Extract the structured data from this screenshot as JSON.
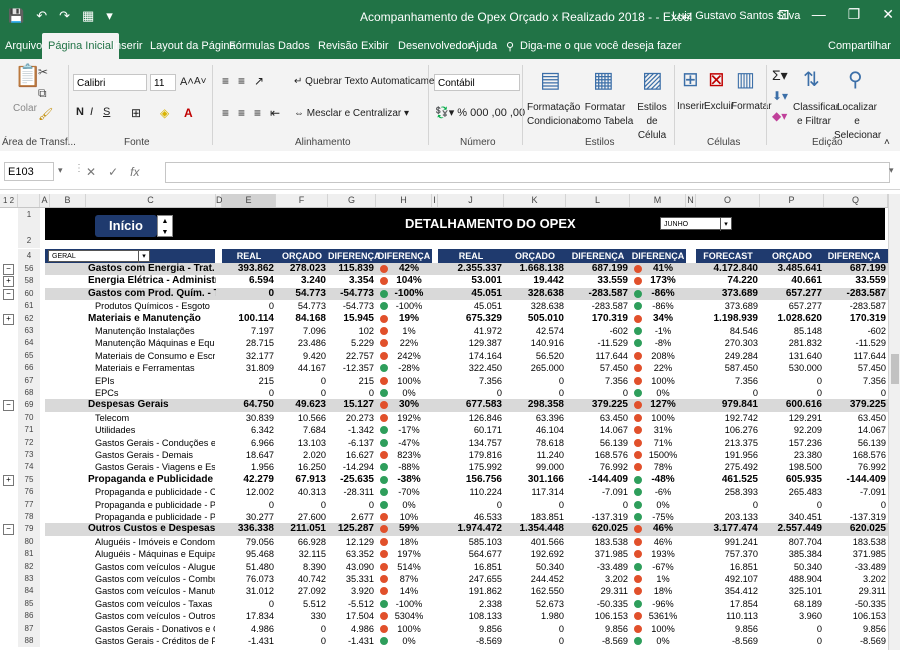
{
  "window": {
    "title": "Acompanhamento de Opex Orçado x Realizado 2018 -       -  Excel",
    "user": "Luiz Gustavo Santos Silva",
    "quick_access": [
      "💾",
      "↶",
      "↷",
      "▦",
      "▾"
    ],
    "win_controls": [
      "⊡",
      "—",
      "❐",
      "✕"
    ]
  },
  "ribbon_tabs": [
    "Arquivo",
    "Página Inicial",
    "Inserir",
    "Layout da Página",
    "Fórmulas",
    "Dados",
    "Revisão",
    "Exibir",
    "Desenvolvedor",
    "Ajuda"
  ],
  "tell_me": "Diga-me o que você deseja fazer",
  "share": "Compartilhar",
  "ribbon": {
    "paste": "Colar",
    "font_name": "Calibri",
    "font_size": "11",
    "wrap_text": "Quebrar Texto Automaticamente",
    "merge_center": "Mesclar e Centralizar",
    "number_format": "Contábil",
    "cond_format": "Formatação Condicional",
    "format_table": "Formatar como Tabela",
    "cell_styles": "Estilos de Célula",
    "insert": "Inserir",
    "delete": "Excluir",
    "format": "Formatar",
    "sort_filter": "Classificar e Filtrar",
    "find_select": "Localizar e Selecionar",
    "groups": [
      "Área de Transf...",
      "Fonte",
      "Alinhamento",
      "Número",
      "Estilos",
      "Células",
      "Edição"
    ]
  },
  "formula_bar": {
    "name_box": "E103",
    "formula": ""
  },
  "columns": [
    "A",
    "B",
    "C",
    "D",
    "E",
    "F",
    "G",
    "H",
    "I",
    "J",
    "K",
    "L",
    "M",
    "N",
    "O",
    "P",
    "Q"
  ],
  "dashboard": {
    "inicio": "Início",
    "title": "DETALHAMENTO DO OPEX",
    "month": "JUNHO",
    "filter": "GERAL",
    "headers": [
      "REAL",
      "ORÇADO",
      "DIFERENÇA",
      "DIFERENÇA (%)",
      "REAL",
      "ORÇADO",
      "DIFERENÇA",
      "DIFERENÇA (%)",
      "FORECAST",
      "ORÇADO",
      "DIFERENÇA"
    ]
  },
  "colors": {
    "green": "#2e9e5b",
    "red": "#e1502b",
    "navy": "#1f3a6e",
    "excel": "#217346"
  },
  "rows": [
    {
      "n": "56",
      "t": "hl",
      "label": "Gastos com Energia - Trat. de Esgoto",
      "v": [
        "393.862",
        "278.023",
        "115.839",
        "42%",
        "2.355.337",
        "1.668.138",
        "687.199",
        "41%",
        "4.172.840",
        "3.485.641",
        "687.199"
      ],
      "d1": "red",
      "d2": "red"
    },
    {
      "n": "58",
      "t": "sub",
      "label": "Energia Elétrica - Administrativo",
      "v": [
        "6.594",
        "3.240",
        "3.354",
        "104%",
        "53.001",
        "19.442",
        "33.559",
        "173%",
        "74.220",
        "40.661",
        "33.559"
      ],
      "d1": "red",
      "d2": "red"
    },
    {
      "n": "60",
      "t": "hl",
      "label": "Gastos com Prod. Quím. - Trat. Esgoto",
      "v": [
        "0",
        "54.773",
        "-54.773",
        "-100%",
        "45.051",
        "328.638",
        "-283.587",
        "-86%",
        "373.689",
        "657.277",
        "-283.587"
      ],
      "d1": "green",
      "d2": "green"
    },
    {
      "n": "61",
      "t": "",
      "label": "Produtos Químicos - Esgoto",
      "v": [
        "0",
        "54.773",
        "-54.773",
        "-100%",
        "45.051",
        "328.638",
        "-283.587",
        "-86%",
        "373.689",
        "657.277",
        "-283.587"
      ],
      "d1": "",
      "d2": ""
    },
    {
      "n": "62",
      "t": "sub",
      "label": "Materiais e Manutenção",
      "v": [
        "100.114",
        "84.168",
        "15.945",
        "19%",
        "675.329",
        "505.010",
        "170.319",
        "34%",
        "1.198.939",
        "1.028.620",
        "170.319"
      ],
      "d1": "red",
      "d2": "red"
    },
    {
      "n": "63",
      "t": "",
      "label": "Manutenção Instalações",
      "v": [
        "7.197",
        "7.096",
        "102",
        "1%",
        "41.972",
        "42.574",
        "-602",
        "-1%",
        "84.546",
        "85.148",
        "-602"
      ],
      "d1": "",
      "d2": ""
    },
    {
      "n": "64",
      "t": "",
      "label": "Manutenção Máquinas e Equipamentos",
      "v": [
        "28.715",
        "23.486",
        "5.229",
        "22%",
        "129.387",
        "140.916",
        "-11.529",
        "-8%",
        "270.303",
        "281.832",
        "-11.529"
      ],
      "d1": "",
      "d2": ""
    },
    {
      "n": "65",
      "t": "",
      "label": "Materiais de Consumo e Escritório",
      "v": [
        "32.177",
        "9.420",
        "22.757",
        "242%",
        "174.164",
        "56.520",
        "117.644",
        "208%",
        "249.284",
        "131.640",
        "117.644"
      ],
      "d1": "",
      "d2": ""
    },
    {
      "n": "66",
      "t": "",
      "label": "Materiais e Ferramentas",
      "v": [
        "31.809",
        "44.167",
        "-12.357",
        "-28%",
        "322.450",
        "265.000",
        "57.450",
        "22%",
        "587.450",
        "530.000",
        "57.450"
      ],
      "d1": "",
      "d2": ""
    },
    {
      "n": "67",
      "t": "",
      "label": "EPIs",
      "v": [
        "215",
        "0",
        "215",
        "100%",
        "7.356",
        "0",
        "7.356",
        "100%",
        "7.356",
        "0",
        "7.356"
      ],
      "d1": "",
      "d2": ""
    },
    {
      "n": "68",
      "t": "",
      "label": "EPCs",
      "v": [
        "0",
        "0",
        "0",
        "0%",
        "0",
        "0",
        "0",
        "0%",
        "0",
        "0",
        "0"
      ],
      "d1": "",
      "d2": ""
    },
    {
      "n": "69",
      "t": "hl",
      "label": "Despesas Gerais",
      "v": [
        "64.750",
        "49.623",
        "15.127",
        "30%",
        "677.583",
        "298.358",
        "379.225",
        "127%",
        "979.841",
        "600.616",
        "379.225"
      ],
      "d1": "red",
      "d2": "red"
    },
    {
      "n": "70",
      "t": "",
      "label": "Telecom",
      "v": [
        "30.839",
        "10.566",
        "20.273",
        "192%",
        "126.846",
        "63.396",
        "63.450",
        "100%",
        "192.742",
        "129.291",
        "63.450"
      ],
      "d1": "",
      "d2": ""
    },
    {
      "n": "71",
      "t": "",
      "label": "Utilidades",
      "v": [
        "6.342",
        "7.684",
        "-1.342",
        "-17%",
        "60.171",
        "46.104",
        "14.067",
        "31%",
        "106.276",
        "92.209",
        "14.067"
      ],
      "d1": "",
      "d2": ""
    },
    {
      "n": "72",
      "t": "",
      "label": "Gastos Gerais - Conduções e Lanches",
      "v": [
        "6.966",
        "13.103",
        "-6.137",
        "-47%",
        "134.757",
        "78.618",
        "56.139",
        "71%",
        "213.375",
        "157.236",
        "56.139"
      ],
      "d1": "",
      "d2": ""
    },
    {
      "n": "73",
      "t": "",
      "label": "Gastos Gerais - Demais",
      "v": [
        "18.647",
        "2.020",
        "16.627",
        "823%",
        "179.816",
        "11.240",
        "168.576",
        "1500%",
        "191.956",
        "23.380",
        "168.576"
      ],
      "d1": "",
      "d2": ""
    },
    {
      "n": "74",
      "t": "",
      "label": "Gastos Gerais - Viagens e Estadias",
      "v": [
        "1.956",
        "16.250",
        "-14.294",
        "-88%",
        "175.992",
        "99.000",
        "76.992",
        "78%",
        "275.492",
        "198.500",
        "76.992"
      ],
      "d1": "",
      "d2": ""
    },
    {
      "n": "75",
      "t": "sub",
      "label": "Propaganda e Publicidade",
      "v": [
        "42.279",
        "67.913",
        "-25.635",
        "-38%",
        "156.756",
        "301.166",
        "-144.409",
        "-48%",
        "461.525",
        "605.935",
        "-144.409"
      ],
      "d1": "green",
      "d2": "green"
    },
    {
      "n": "76",
      "t": "",
      "label": "Propaganda e publicidade - Campanhas e Eventos",
      "v": [
        "12.002",
        "40.313",
        "-28.311",
        "-70%",
        "110.224",
        "117.314",
        "-7.091",
        "-6%",
        "258.393",
        "265.483",
        "-7.091"
      ],
      "d1": "",
      "d2": ""
    },
    {
      "n": "77",
      "t": "",
      "label": "Propaganda e publicidade - Publicação Legal",
      "v": [
        "0",
        "0",
        "0",
        "0%",
        "0",
        "0",
        "0",
        "0%",
        "0",
        "0",
        "0"
      ],
      "d1": "",
      "d2": ""
    },
    {
      "n": "78",
      "t": "",
      "label": "Propaganda e publicidade - Publicidade",
      "v": [
        "30.277",
        "27.600",
        "2.677",
        "10%",
        "46.533",
        "183.851",
        "-137.319",
        "-75%",
        "203.133",
        "340.451",
        "-137.319"
      ],
      "d1": "",
      "d2": ""
    },
    {
      "n": "79",
      "t": "hl",
      "label": "Outros Custos e Despesas",
      "v": [
        "336.338",
        "211.051",
        "125.287",
        "59%",
        "1.974.472",
        "1.354.448",
        "620.025",
        "46%",
        "3.177.474",
        "2.557.449",
        "620.025"
      ],
      "d1": "red",
      "d2": "red"
    },
    {
      "n": "80",
      "t": "",
      "label": "Aluguéis - Imóveis e Condomínios",
      "v": [
        "79.056",
        "66.928",
        "12.129",
        "18%",
        "585.103",
        "401.566",
        "183.538",
        "46%",
        "991.241",
        "807.704",
        "183.538"
      ],
      "d1": "",
      "d2": ""
    },
    {
      "n": "81",
      "t": "",
      "label": "Aluguéis - Máquinas e Equipamentos",
      "v": [
        "95.468",
        "32.115",
        "63.352",
        "197%",
        "564.677",
        "192.692",
        "371.985",
        "193%",
        "757.370",
        "385.384",
        "371.985"
      ],
      "d1": "",
      "d2": ""
    },
    {
      "n": "82",
      "t": "",
      "label": "Gastos com veículos - Alugueis",
      "v": [
        "51.480",
        "8.390",
        "43.090",
        "514%",
        "16.851",
        "50.340",
        "-33.489",
        "-67%",
        "16.851",
        "50.340",
        "-33.489"
      ],
      "d1": "",
      "d2": ""
    },
    {
      "n": "83",
      "t": "",
      "label": "Gastos com veículos - Combustível",
      "v": [
        "76.073",
        "40.742",
        "35.331",
        "87%",
        "247.655",
        "244.452",
        "3.202",
        "1%",
        "492.107",
        "488.904",
        "3.202"
      ],
      "d1": "",
      "d2": ""
    },
    {
      "n": "84",
      "t": "",
      "label": "Gastos com veículos - Manutenção",
      "v": [
        "31.012",
        "27.092",
        "3.920",
        "14%",
        "191.862",
        "162.550",
        "29.311",
        "18%",
        "354.412",
        "325.101",
        "29.311"
      ],
      "d1": "",
      "d2": ""
    },
    {
      "n": "85",
      "t": "",
      "label": "Gastos com veículos - Taxas e Licenciamento",
      "v": [
        "0",
        "5.512",
        "-5.512",
        "-100%",
        "2.338",
        "52.673",
        "-50.335",
        "-96%",
        "17.854",
        "68.189",
        "-50.335"
      ],
      "d1": "",
      "d2": ""
    },
    {
      "n": "86",
      "t": "",
      "label": "Gastos com veículos - Outros gastos com veículos",
      "v": [
        "17.834",
        "330",
        "17.504",
        "5304%",
        "108.133",
        "1.980",
        "106.153",
        "5361%",
        "110.113",
        "3.960",
        "106.153"
      ],
      "d1": "",
      "d2": ""
    },
    {
      "n": "87",
      "t": "",
      "label": "Gastos Gerais - Donativos e Contribuições",
      "v": [
        "4.986",
        "0",
        "4.986",
        "100%",
        "9.856",
        "0",
        "9.856",
        "100%",
        "9.856",
        "0",
        "9.856"
      ],
      "d1": "",
      "d2": ""
    },
    {
      "n": "88",
      "t": "",
      "label": "Gastos Gerais - Créditos de PIS/COFINS s/ aluguéis",
      "v": [
        "-1.431",
        "0",
        "-1.431",
        "0%",
        "-8.569",
        "0",
        "-8.569",
        "0%",
        "-8.569",
        "0",
        "-8.569"
      ],
      "d1": "",
      "d2": ""
    }
  ]
}
